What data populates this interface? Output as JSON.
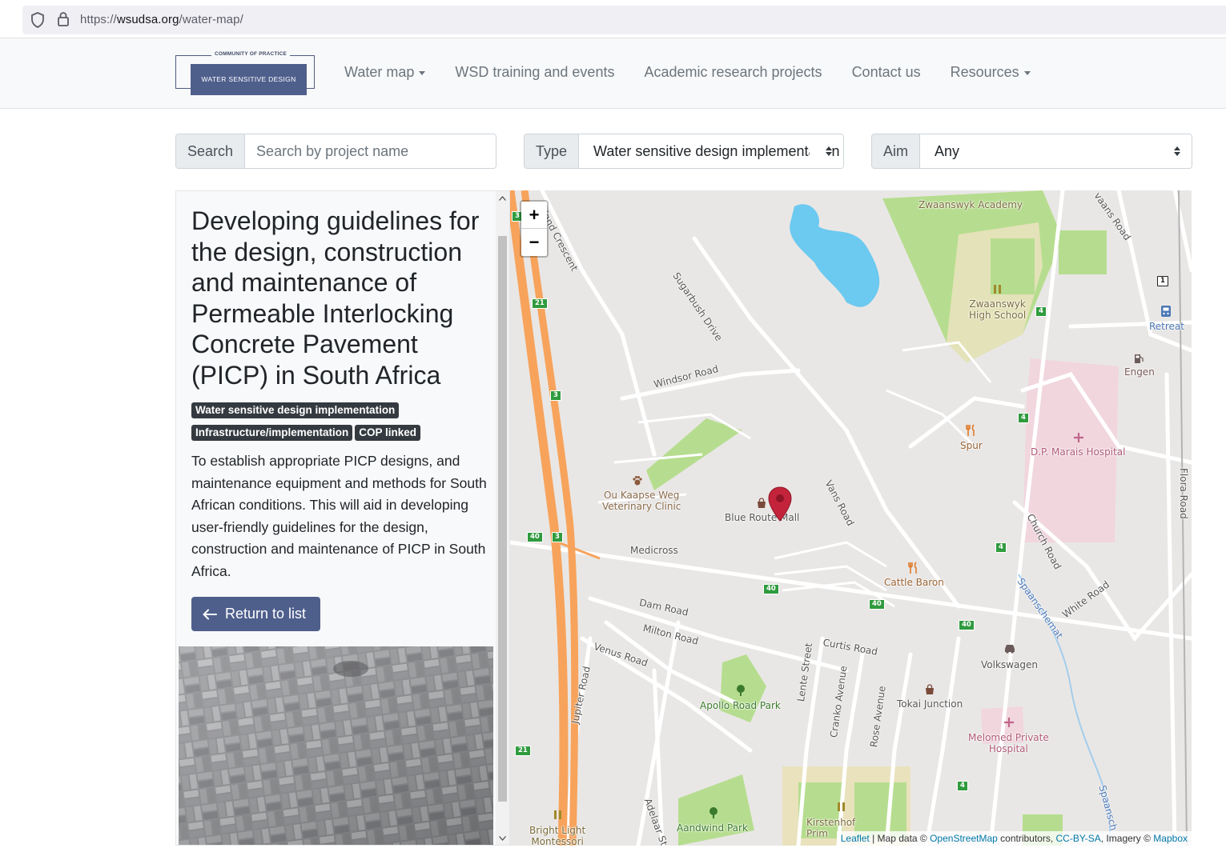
{
  "browser": {
    "url_prefix": "https://",
    "url_host": "wsudsa.org",
    "url_path": "/water-map/"
  },
  "logo": {
    "top_text": "COMMUNITY OF PRACTICE",
    "main_text": "WATER SENSITIVE DESIGN"
  },
  "nav": {
    "items": [
      {
        "label": "Water map",
        "dropdown": true
      },
      {
        "label": "WSD training and events",
        "dropdown": false
      },
      {
        "label": "Academic research projects",
        "dropdown": false
      },
      {
        "label": "Contact us",
        "dropdown": false
      },
      {
        "label": "Resources",
        "dropdown": true
      }
    ]
  },
  "filters": {
    "search_label": "Search",
    "search_placeholder": "Search by project name",
    "type_label": "Type",
    "type_value": "Water sensitive design implementation",
    "aim_label": "Aim",
    "aim_value": "Any"
  },
  "project": {
    "title": "Developing guidelines for the design, construction and maintenance of Permeable Interlocking Concrete Pavement (PICP) in South Africa",
    "badges": [
      "Water sensitive design implementation",
      "Infrastructure/implementation",
      "COP linked"
    ],
    "description": "To establish appropriate PICP designs, and maintenance equipment and methods for South African conditions. This will aid in developing user-friendly guidelines for the design, construction and maintenance of PICP in South Africa.",
    "return_label": "Return to list"
  },
  "map": {
    "zoom_in": "+",
    "zoom_out": "−",
    "labels": {
      "zwaanswyk_academy": "Zwaanswyk Academy",
      "zwaanswyk_high": "Zwaanswyk\nHigh School",
      "retreat": "Retreat",
      "engen": "Engen",
      "spur": "Spur",
      "dp_marais": "D.P. Marais Hospital",
      "vet_clinic": "Ou Kaapse Weg\nVeterinary Clinic",
      "blue_route": "Blue Route Mall",
      "medicross": "Medicross",
      "cattle_baron": "Cattle Baron",
      "volkswagen": "Volkswagen",
      "tokai_junction": "Tokai Junction",
      "melomed": "Melomed Private\nHospital",
      "apollo_park": "Apollo Road Park",
      "aandwind_park": "Aandwind Park",
      "kirstenhof": "Kirstenhof\nPrim",
      "bright_light": "Bright Light\nMontessori",
      "windsor_road": "Windsor Road",
      "dam_road": "Dam Road",
      "milton_road": "Milton Road",
      "venus_road": "Venus Road",
      "curtis_road": "Curtis Road",
      "vans_road": "Vans Road",
      "church_road": "Church Road",
      "white_road": "White Road",
      "flora_road": "Flora Road",
      "sugarbush_drive": "Sugarbush Drive",
      "island_crescent": "Island Crescent",
      "jupiter_road": "Jupiter Road",
      "lente_street": "Lente Street",
      "cranko_avenue": "Cranko Avenue",
      "rose_avenue": "Rose Avenue",
      "adelaar_street": "Adelaar St",
      "spaanschemat": "Spaanschemat",
      "spaansch": "Spaansch",
      "vaans_road": "vaans Road"
    },
    "shields": [
      "3",
      "21",
      "3",
      "40",
      "3",
      "40",
      "40",
      "40",
      "4",
      "4",
      "4",
      "4",
      "21",
      "1"
    ],
    "attribution": {
      "leaflet": "Leaflet",
      "map_data": " | Map data © ",
      "osm": "OpenStreetMap",
      "contributors": " contributors, ",
      "license": "CC-BY-SA",
      "imagery": ", Imagery © ",
      "mapbox": "Mapbox"
    }
  }
}
